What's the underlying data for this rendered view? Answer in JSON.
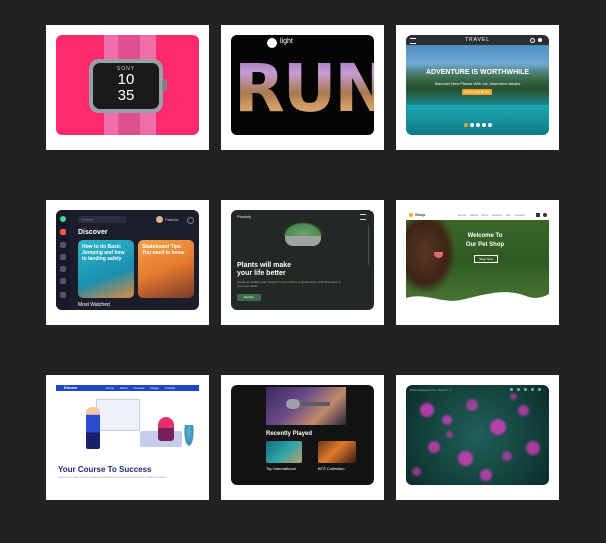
{
  "watch": {
    "brand": "SONY",
    "hour": "10",
    "minute": "35"
  },
  "run": {
    "logo": "light",
    "headline": "RUN"
  },
  "travel": {
    "brand": "TRAVEL",
    "headline": "ADVENTURE IS WORTHWHILE",
    "subtitle": "Discover New Places With Us, Adventure Awaits",
    "cta": "DISCOVER MORE"
  },
  "dashboard": {
    "search": "Search",
    "user": "Patricia",
    "section": "Discover",
    "card1": "How to do Basic Jumping and how to landing safely",
    "card2": "Skateboard Tips You need to know",
    "footer": "Most Watched"
  },
  "plants": {
    "brand": "Plantsfy",
    "headline": "Plants will make your life better",
    "body": "Create incredible plant design for your offices or apartments. Add freshness to your new ideas.",
    "cta": "Explore"
  },
  "pet": {
    "brand": "Shop",
    "nav": [
      "Home",
      "About",
      "Shop",
      "Service",
      "Pet",
      "Contact"
    ],
    "headline": "Welcome To Our Pet Shop",
    "cta": "Shop Now"
  },
  "course": {
    "brand": "Edcare",
    "nav": [
      "Home",
      "About",
      "Courses",
      "Pages",
      "Contact"
    ],
    "headline": "Your Course To Success",
    "body": "Lorem ipsum dolor sit amet consectetur adipiscing elit sed do eiusmod tempor incididunt ut labore"
  },
  "music": {
    "section": "Recently Played",
    "item1": "Top International",
    "item2": "BTS Collection"
  },
  "bokeh": {
    "title": "Bokeh Background - Gold Pt. 2"
  }
}
